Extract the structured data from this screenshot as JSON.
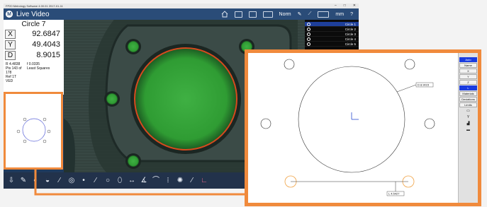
{
  "window": {
    "os_title": "FP20 Metrology Software 4.00.01 2017-01-11",
    "controls": [
      "–",
      "□",
      "✕"
    ]
  },
  "toolbar": {
    "logo": "M",
    "title": "Live Video",
    "mode": "Norm",
    "units": "mm",
    "help": "?"
  },
  "dro": {
    "feature_title": "Circle 7",
    "rows": [
      {
        "axis": "X",
        "value": "92.6847"
      },
      {
        "axis": "Y",
        "value": "49.4043"
      },
      {
        "axis": "D",
        "value": "8.9015"
      }
    ],
    "info": [
      {
        "left": "R   4.4838",
        "right": "f    0.0335"
      },
      {
        "left": "Pts 143 of 178",
        "right": "Least Squares"
      },
      {
        "left": "Ref 1T",
        "right": ""
      },
      {
        "left": "VED",
        "right": ""
      }
    ]
  },
  "features": {
    "items": [
      {
        "label": "Circle 1"
      },
      {
        "label": "Circle 2"
      },
      {
        "label": "Circle 3"
      },
      {
        "label": "Circle 4"
      },
      {
        "label": "Circle 5"
      }
    ]
  },
  "bottom_tools": [
    {
      "name": "export-icon",
      "glyph": "⇩"
    },
    {
      "name": "probe-icon",
      "glyph": "✎"
    },
    {
      "name": "light-icon",
      "glyph": "◐"
    },
    {
      "name": "edge-icon",
      "glyph": "◒"
    },
    {
      "name": "pen-icon",
      "glyph": "∕"
    },
    {
      "name": "target-icon",
      "glyph": "◎"
    },
    {
      "name": "point-icon",
      "glyph": "•"
    },
    {
      "name": "line-icon",
      "glyph": "∕"
    },
    {
      "name": "circle-icon",
      "glyph": "○"
    },
    {
      "name": "slot-icon",
      "glyph": "⬯"
    },
    {
      "name": "distance-icon",
      "glyph": "↔"
    },
    {
      "name": "angle-icon",
      "glyph": "∡"
    },
    {
      "name": "arc-icon",
      "glyph": "⌒"
    },
    {
      "name": "blob-icon",
      "glyph": "⦙"
    },
    {
      "name": "gear-icon",
      "glyph": "✺"
    },
    {
      "name": "wand-icon",
      "glyph": "⁄"
    },
    {
      "name": "axis-icon",
      "glyph": "∟",
      "pink": true
    }
  ],
  "zoom_panel": {
    "buttons": [
      {
        "label": "Auto",
        "on": true
      },
      {
        "label": "Name",
        "on": false
      },
      {
        "label": "X",
        "on": false
      },
      {
        "label": "Y",
        "on": false
      },
      {
        "label": "Z",
        "on": false
      },
      {
        "label": "L",
        "on": true
      },
      {
        "label": "Materials",
        "on": false
      },
      {
        "label": "Deviations",
        "on": false
      },
      {
        "label": "Limits",
        "on": false
      }
    ],
    "tool_icons": [
      {
        "name": "rect-icon",
        "glyph": "▭"
      },
      {
        "name": "y-icon",
        "glyph": "Y"
      },
      {
        "name": "bars-icon",
        "glyph": "▟"
      },
      {
        "name": "scale-icon",
        "glyph": "▬"
      }
    ],
    "diameter_label": "D  8.9015",
    "distance_label": "L  4.5427"
  },
  "colors": {
    "accent": "#f08a3c",
    "toolbar": "#2a4c78",
    "selected": "#1a3ce0",
    "hole_green": "#2e9a34",
    "part_overlay": "#d64a1e"
  }
}
